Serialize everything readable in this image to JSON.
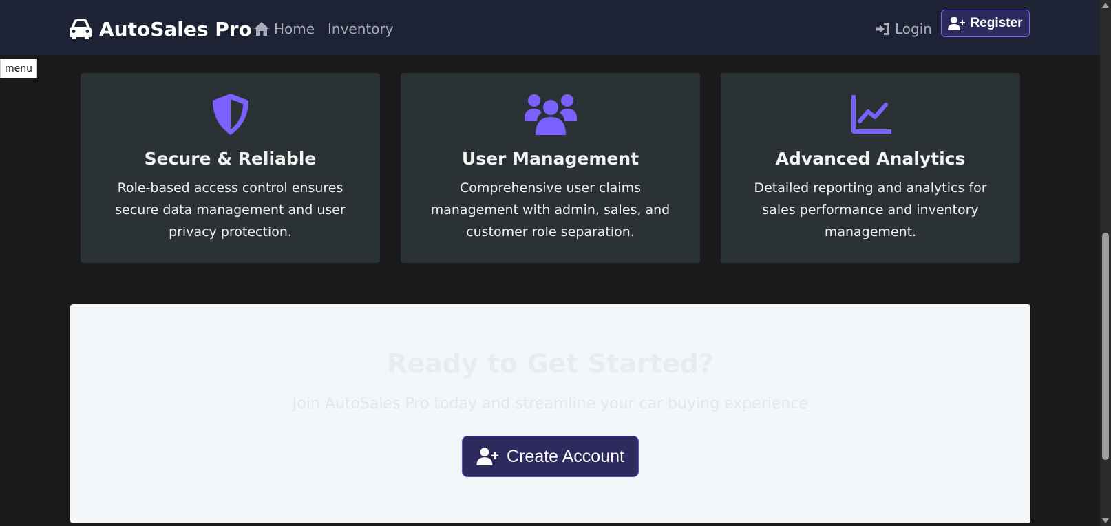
{
  "navbar": {
    "brand": "AutoSales Pro",
    "brand_icon": "car-icon",
    "links": [
      {
        "label": "Home",
        "icon": "home-icon"
      },
      {
        "label": "Inventory"
      }
    ],
    "login_label": "Login",
    "register_label": "Register",
    "accent": "#7b68ee"
  },
  "menu_tab": "menu",
  "features": [
    {
      "icon": "shield-icon",
      "title": "Secure & Reliable",
      "text": "Role-based access control ensures secure data management and user privacy protection."
    },
    {
      "icon": "users-icon",
      "title": "User Management",
      "text": "Comprehensive user claims management with admin, sales, and customer role separation."
    },
    {
      "icon": "chart-line-icon",
      "title": "Advanced Analytics",
      "text": "Detailed reporting and analytics for sales performance and inventory management."
    }
  ],
  "cta": {
    "title": "Ready to Get Started?",
    "subtitle": "Join AutoSales Pro today and streamline your car buying experience",
    "button_label": "Create Account"
  },
  "colors": {
    "navbar_bg": "#1e2235",
    "page_bg": "#1a1a1a",
    "card_bg": "#2b3235",
    "icon_purple": "#7b61ff",
    "button_bg": "#2e2a5e"
  }
}
